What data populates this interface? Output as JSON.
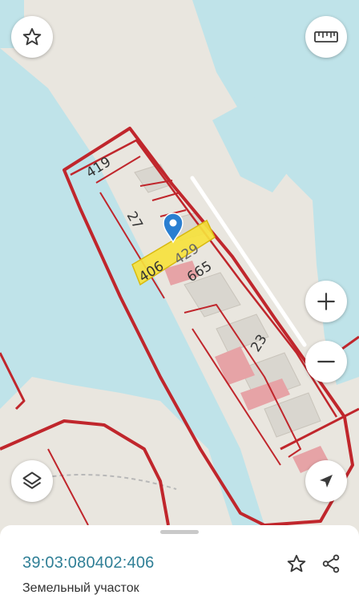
{
  "map": {
    "parcel_labels": [
      "419",
      "27",
      "406",
      "429",
      "665",
      "23"
    ],
    "colors": {
      "water": "#bfe3e9",
      "land": "#e9e6df",
      "boundary": "#c0262c",
      "highlight": "#f6e23d",
      "building": "#d9d6cf",
      "pink_building": "#e6a3a6",
      "pin": "#2a7fd1"
    }
  },
  "controls": {
    "favorite_icon": "star-outline-icon",
    "ruler_icon": "ruler-icon",
    "zoom_in_icon": "plus-icon",
    "zoom_out_icon": "minus-icon",
    "layers_icon": "layers-icon",
    "location_icon": "navigation-arrow-icon"
  },
  "sheet": {
    "cadastral_number": "39:03:080402:406",
    "object_type": "Земельный участок",
    "favorite_icon": "star-outline-icon",
    "share_icon": "share-icon"
  }
}
